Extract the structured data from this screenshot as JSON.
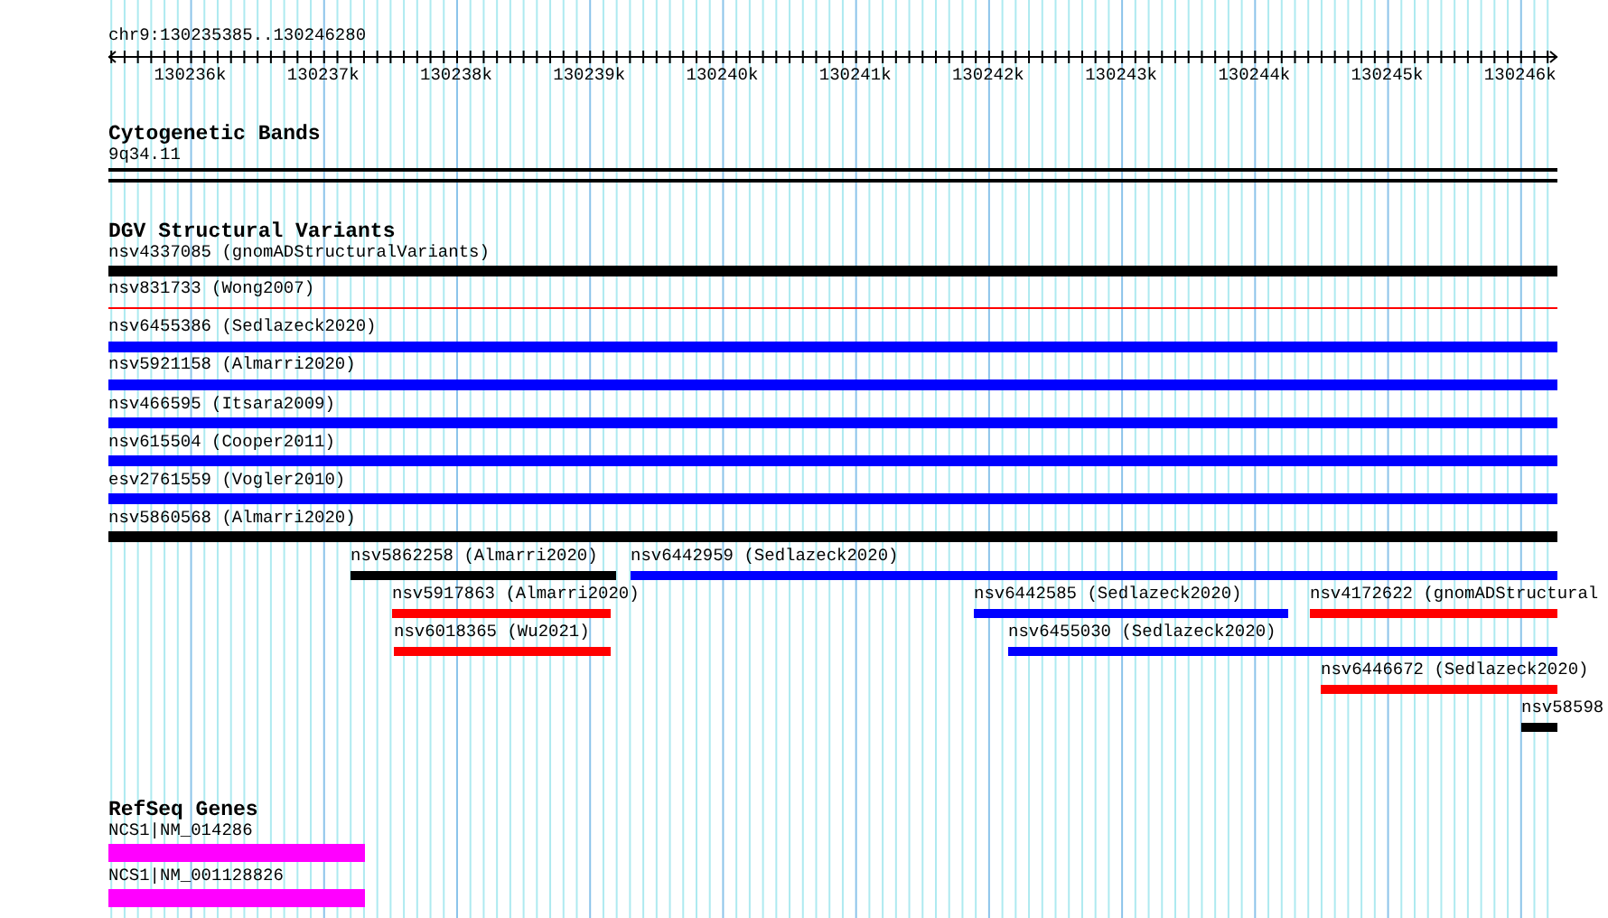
{
  "ruler": {
    "location": "chr9:130235385..130246280",
    "ticks": [
      "130236k",
      "130237k",
      "130238k",
      "130239k",
      "130240k",
      "130241k",
      "130242k",
      "130243k",
      "130244k",
      "130245k",
      "130246k"
    ]
  },
  "tracks": [
    {
      "title": "Cytogenetic Bands",
      "kind": "bands",
      "features": [
        {
          "label": "9q34.11"
        }
      ]
    },
    {
      "title": "DGV Structural Variants",
      "kind": "variants",
      "features": [
        {
          "label": "nsv4337085 (gnomADStructuralVariants)",
          "color": "#000000",
          "kind": "bar"
        },
        {
          "label": "nsv831733 (Wong2007)",
          "color": "#ff0000",
          "kind": "line"
        },
        {
          "label": "nsv6455386 (Sedlazeck2020)",
          "color": "#0000ff",
          "kind": "bar"
        },
        {
          "label": "nsv5921158 (Almarri2020)",
          "color": "#0000ff",
          "kind": "bar"
        },
        {
          "label": "nsv466595 (Itsara2009)",
          "color": "#0000ff",
          "kind": "bar"
        },
        {
          "label": "nsv615504 (Cooper2011)",
          "color": "#0000ff",
          "kind": "bar"
        },
        {
          "label": "esv2761559 (Vogler2010)",
          "color": "#0000ff",
          "kind": "bar"
        },
        {
          "label": "nsv5860568 (Almarri2020)",
          "color": "#000000",
          "kind": "bar"
        },
        {
          "label": "nsv5862258 (Almarri2020)",
          "color": "#000000",
          "kind": "bar"
        },
        {
          "label": "nsv6442959 (Sedlazeck2020)",
          "color": "#0000ff",
          "kind": "bar"
        },
        {
          "label": "nsv5917863 (Almarri2020)",
          "color": "#ff0000",
          "kind": "bar"
        },
        {
          "label": "nsv6442585 (Sedlazeck2020)",
          "color": "#0000ff",
          "kind": "bar"
        },
        {
          "label": "nsv4172622 (gnomADStructural",
          "color": "#ff0000",
          "kind": "bar"
        },
        {
          "label": "nsv6018365 (Wu2021)",
          "color": "#ff0000",
          "kind": "bar"
        },
        {
          "label": "nsv6455030 (Sedlazeck2020)",
          "color": "#0000ff",
          "kind": "bar"
        },
        {
          "label": "nsv6446672 (Sedlazeck2020)",
          "color": "#ff0000",
          "kind": "bar"
        },
        {
          "label": "nsv58598",
          "color": "#000000",
          "kind": "bar"
        }
      ]
    },
    {
      "title": "RefSeq Genes",
      "kind": "genes",
      "features": [
        {
          "label": "NCS1|NM_014286",
          "color": "#ff00ff"
        },
        {
          "label": "NCS1|NM_001128826",
          "color": "#ff00ff"
        }
      ]
    }
  ]
}
